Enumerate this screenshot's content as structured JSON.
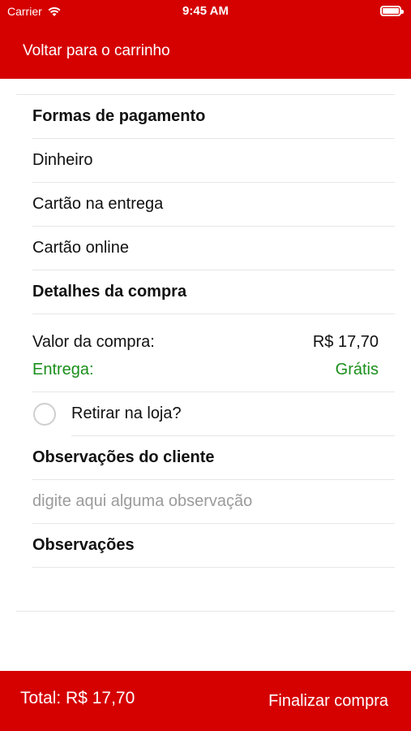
{
  "status_bar": {
    "carrier": "Carrier",
    "time": "9:45 AM"
  },
  "header": {
    "back_label": "Voltar para o carrinho",
    "background_color": "#d50000"
  },
  "payment": {
    "title": "Formas de pagamento",
    "options": [
      "Dinheiro",
      "Cartão na entrega",
      "Cartão online"
    ]
  },
  "details": {
    "title": "Detalhes da compra",
    "purchase_label": "Valor da compra:",
    "purchase_value": "R$ 17,70",
    "delivery_label": "Entrega:",
    "delivery_value": "Grátis",
    "pickup_label": "Retirar na loja?",
    "pickup_checked": false
  },
  "customer_notes": {
    "title": "Observações do cliente",
    "placeholder": "digite aqui alguma observação"
  },
  "notes": {
    "title": "Observações"
  },
  "footer": {
    "total_label": "Total: R$ 17,70",
    "finalize_label": "Finalizar compra"
  }
}
